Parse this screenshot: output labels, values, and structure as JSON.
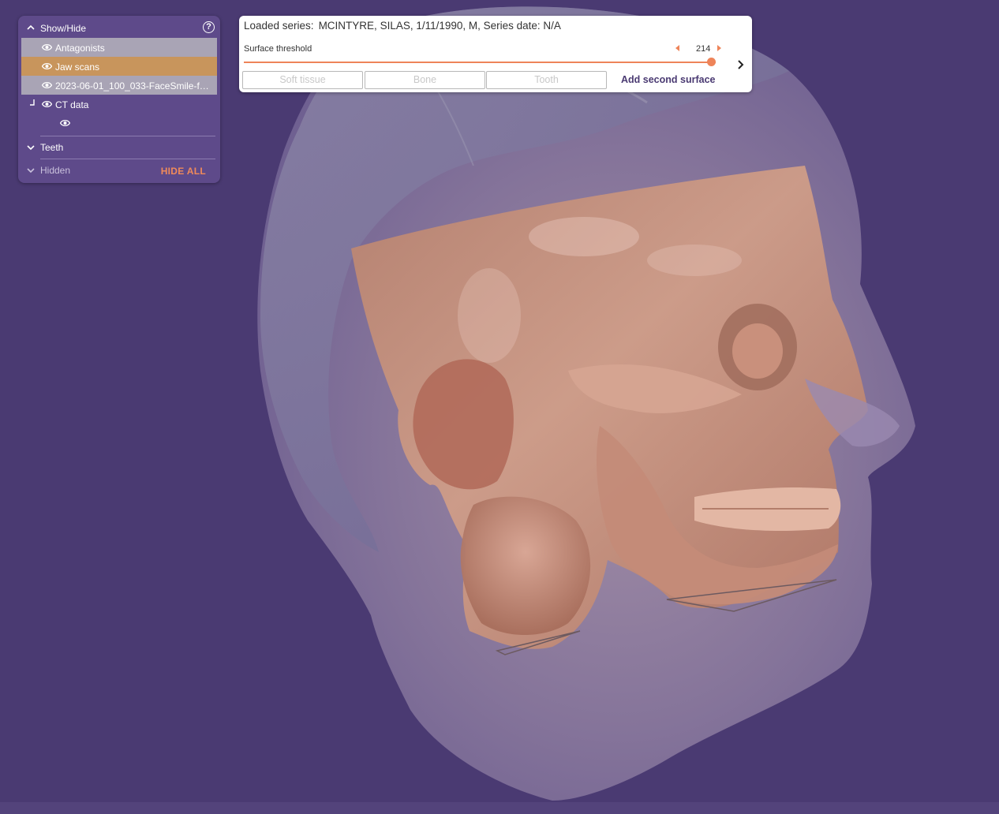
{
  "colors": {
    "background": "#4a3a72",
    "panel": "#5e4a8a",
    "accent": "#ee8459",
    "row_gray": "#a9a4b5",
    "row_orange": "#c8955c"
  },
  "panel": {
    "title": "Show/Hide",
    "help_icon": "question-circle-icon",
    "help_glyph": "?",
    "items": [
      {
        "label": "Antagonists",
        "icon": "eye-icon",
        "state": "gray"
      },
      {
        "label": "Jaw scans",
        "icon": "eye-icon",
        "state": "selected-orange"
      },
      {
        "label": "2023-06-01_100_033-FaceSmile-face.obj",
        "icon": "eye-icon",
        "state": "gray"
      },
      {
        "label": "CT data",
        "icon": "eye-icon",
        "state": "normal"
      },
      {
        "label": "",
        "icon": "eye-icon",
        "state": "child"
      }
    ],
    "teeth_label": "Teeth",
    "hidden_label": "Hidden",
    "hide_all_label": "HIDE ALL"
  },
  "series": {
    "prefix": "Loaded series:",
    "value": "MCINTYRE, SILAS, 1/11/1990, M, Series date: N/A"
  },
  "threshold": {
    "label": "Surface threshold",
    "value": "214",
    "level_fraction": 0.99
  },
  "presets": [
    "Soft tissue",
    "Bone",
    "Tooth"
  ],
  "add_surface_label": "Add second surface"
}
